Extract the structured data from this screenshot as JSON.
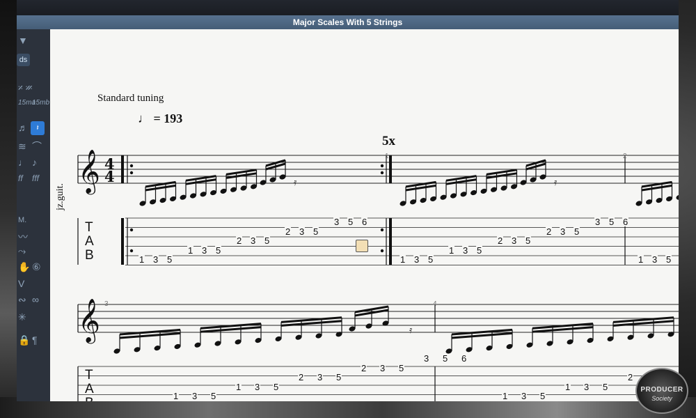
{
  "window": {
    "title": "Major Scales With 5 Strings"
  },
  "sidebar": {
    "top_button_label": "ds",
    "row1": "𝄎 𝄏",
    "ottava_labels": [
      "15ma",
      "15mb"
    ],
    "section_label": "M."
  },
  "score": {
    "tuning": "Standard tuning",
    "tempo_value": "= 193",
    "repeat_count": "5x",
    "instrument": "jz.guit.",
    "time_signature": {
      "top": "4",
      "bottom": "4"
    },
    "bar_numbers": [
      "1",
      "2",
      "3",
      "4"
    ],
    "tab_letters": [
      "T",
      "A",
      "B"
    ],
    "tab_frets": {
      "string6": [
        "1",
        "3",
        "5"
      ],
      "string5": [
        "1",
        "3",
        "5"
      ],
      "string4": [
        "2",
        "3",
        "5"
      ],
      "string3": [
        "2",
        "3",
        "5"
      ],
      "string2": [
        "3",
        "5",
        "6"
      ]
    }
  },
  "watermark": {
    "line1": "PRODUCER",
    "line2": "Society"
  },
  "colors": {
    "titlebar": "#4f6a86",
    "sidebar": "#2c323c",
    "paper": "#f6f6f4",
    "active_tool": "#2e7bd6"
  }
}
